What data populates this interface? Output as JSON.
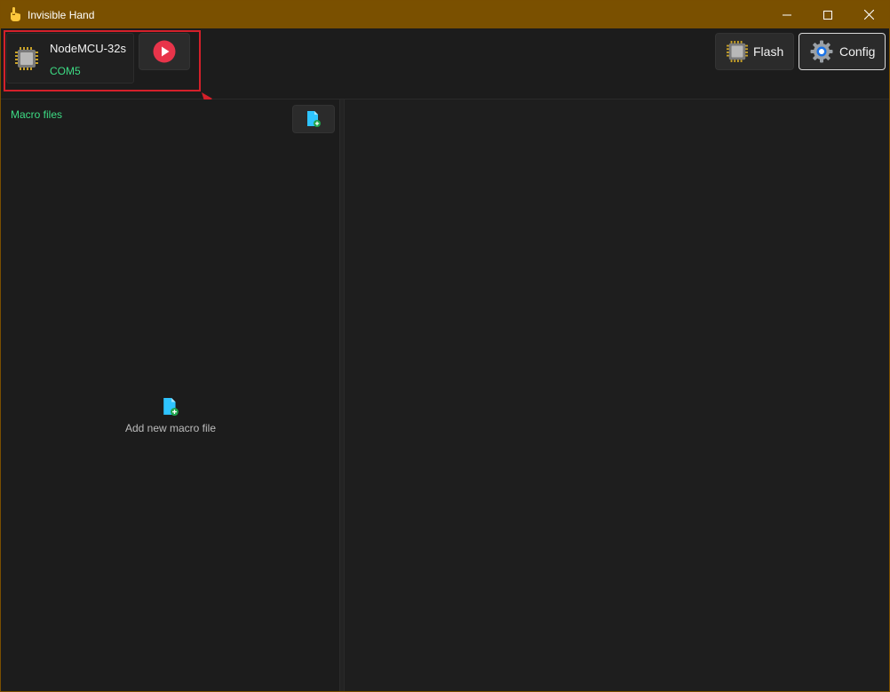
{
  "window": {
    "title": "Invisible Hand",
    "icon": "hand-pointer-icon",
    "controls": [
      "minimize-icon",
      "maximize-icon",
      "close-icon"
    ]
  },
  "toolbar": {
    "device": {
      "name": "NodeMCU-32s",
      "port": "COM5",
      "icon": "chip-icon"
    },
    "run_icon": "play-icon",
    "flash_label": "Flash",
    "config_label": "Config"
  },
  "macro_panel": {
    "title": "Macro files",
    "new_file_icon": "add-file-icon",
    "empty_text": "Add new macro file"
  },
  "colors": {
    "titlebar": "#7a5000",
    "accent_green": "#3ddc84",
    "play_red": "#e8344a",
    "annotation_red": "#d4202a",
    "file_icon_cyan": "#2ec4ff"
  }
}
